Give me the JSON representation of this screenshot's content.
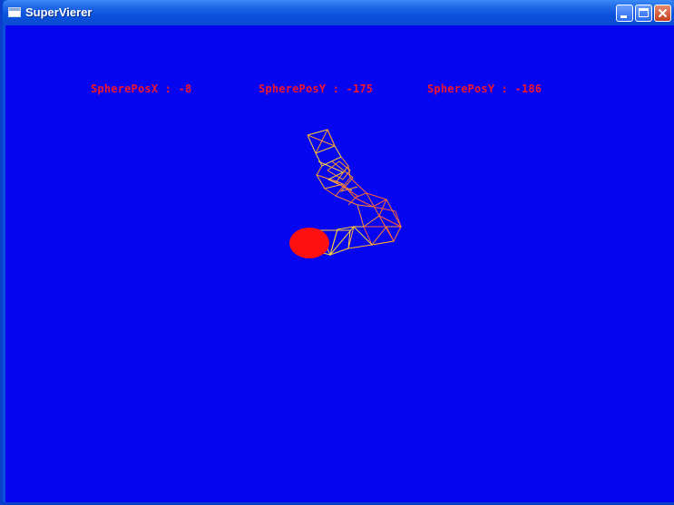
{
  "window": {
    "title": "SuperVierer",
    "icon": "window-app-icon",
    "buttons": [
      "minimize",
      "maximize",
      "close"
    ]
  },
  "hud": {
    "sphere_pos_x": "SpherePosX : -8",
    "sphere_pos_y_1": "SpherePosY : -175",
    "sphere_pos_y_2": "SpherePosY : -186"
  },
  "colors": {
    "background": "#0505f0",
    "hud_text": "#f2162f",
    "sphere": "#ff1010",
    "wireframe_orange": "#ff9a2a",
    "wireframe_yellow": "#ffd23a",
    "wireframe_red": "#ff5a3a"
  }
}
